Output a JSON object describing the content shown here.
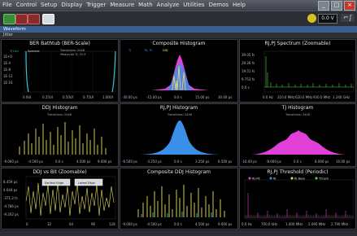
{
  "menu": [
    "File",
    "Control",
    "Setup",
    "Display",
    "Trigger",
    "Measure",
    "Math",
    "Analyze",
    "Utilities",
    "Demos",
    "Help"
  ],
  "window_controls": {
    "minimize": "_",
    "maximize": "□",
    "close": "×"
  },
  "toolbar": {
    "voltage": "0.0 V",
    "edge_symbol": "⌐∫"
  },
  "waveform_label": "Waveform",
  "jitter_label": "Jitter",
  "status_text": "",
  "colors": {
    "yellow": "#e8e05a",
    "magenta": "#e040d8",
    "blue": "#3a8fe8",
    "cyan": "#2ec8d8",
    "green": "#58d848",
    "grid": "#2a2a2a"
  },
  "panels": {
    "bathtub": {
      "title": "BER Bathtub (BER-Scale)",
      "legend": [
        "TJ Lim",
        "Spectral"
      ],
      "info": [
        "Transitions: 2448",
        "Measured TJ: 32.9"
      ],
      "yticks": [
        "1E+0",
        "1E-4",
        "1E-8",
        "1E-12",
        "1E-16"
      ],
      "xticks": [
        "0.0UI",
        "0.25UI",
        "0.50UI",
        "0.75UI",
        "1.00UI"
      ]
    },
    "composite_hist": {
      "title": "Composite Histogram",
      "legend": [
        "TJ",
        "RJ, PJ",
        "DDJ"
      ],
      "xticks": [
        "-30.00 ps",
        "-15.00 ps",
        "0.0 s",
        "15.00 ps",
        "30.00 ps"
      ]
    },
    "rjpj_spectrum": {
      "title": "RJ,PJ Spectrum (Zoomable)",
      "yticks": [
        "39.05 fs",
        "29.26 fs",
        "19.51 fs",
        "9.753 fs",
        "0.0 s"
      ],
      "xticks": [
        "0.0 Hz",
        "310.0 MHz",
        "620.0 MHz",
        "930.0 MHz",
        "1.240 GHz"
      ]
    },
    "ddj_hist": {
      "title": "DDJ Histogram",
      "info": "Transitions: 2448",
      "xticks": [
        "-9.000 ps",
        "-4.500 ps",
        "0.0 s",
        "4.500 ps",
        "9.000 ps"
      ]
    },
    "rjpj_hist": {
      "title": "RJ,PJ Histogram",
      "info": "Transitions: 2448",
      "xticks": [
        "-6.500 ps",
        "-3.250 ps",
        "0.0 s",
        "3.250 ps",
        "6.500 ps"
      ]
    },
    "tj_hist": {
      "title": "TJ Histogram",
      "info": "Transitions: 2448",
      "xticks": [
        "-16.00 ps",
        "-8.000 ps",
        "0.0 s",
        "8.000 ps",
        "16.00 ps"
      ]
    },
    "ddj_vs_bit": {
      "title": "DDJ vs Bit (Zoomable)",
      "buttons": [
        "Earliest Edge",
        "Latest Edge"
      ],
      "yticks": [
        "8.459 ps",
        "4.044 ps",
        "-371.2 fs",
        "-4.786 ps",
        "-9.202 ps"
      ],
      "xticks": [
        "0",
        "32",
        "64",
        "96",
        "128"
      ]
    },
    "composite_ddj": {
      "title": "Composite DDJ Histogram",
      "xticks": [
        "-9.000 ps",
        "-4.500 ps",
        "0.0 s",
        "4.500 ps",
        "9.000 ps"
      ]
    },
    "rjpj_threshold": {
      "title": "RJ,PJ Threshold (Periodic)",
      "legend": [
        "RJ+PJ",
        "RJ",
        "RJ Base",
        "Thresh"
      ],
      "xticks": [
        "0.0 Hz",
        "700.0 kHz",
        "1.400 MHz",
        "2.090 MHz",
        "2.790 MHz"
      ]
    }
  }
}
